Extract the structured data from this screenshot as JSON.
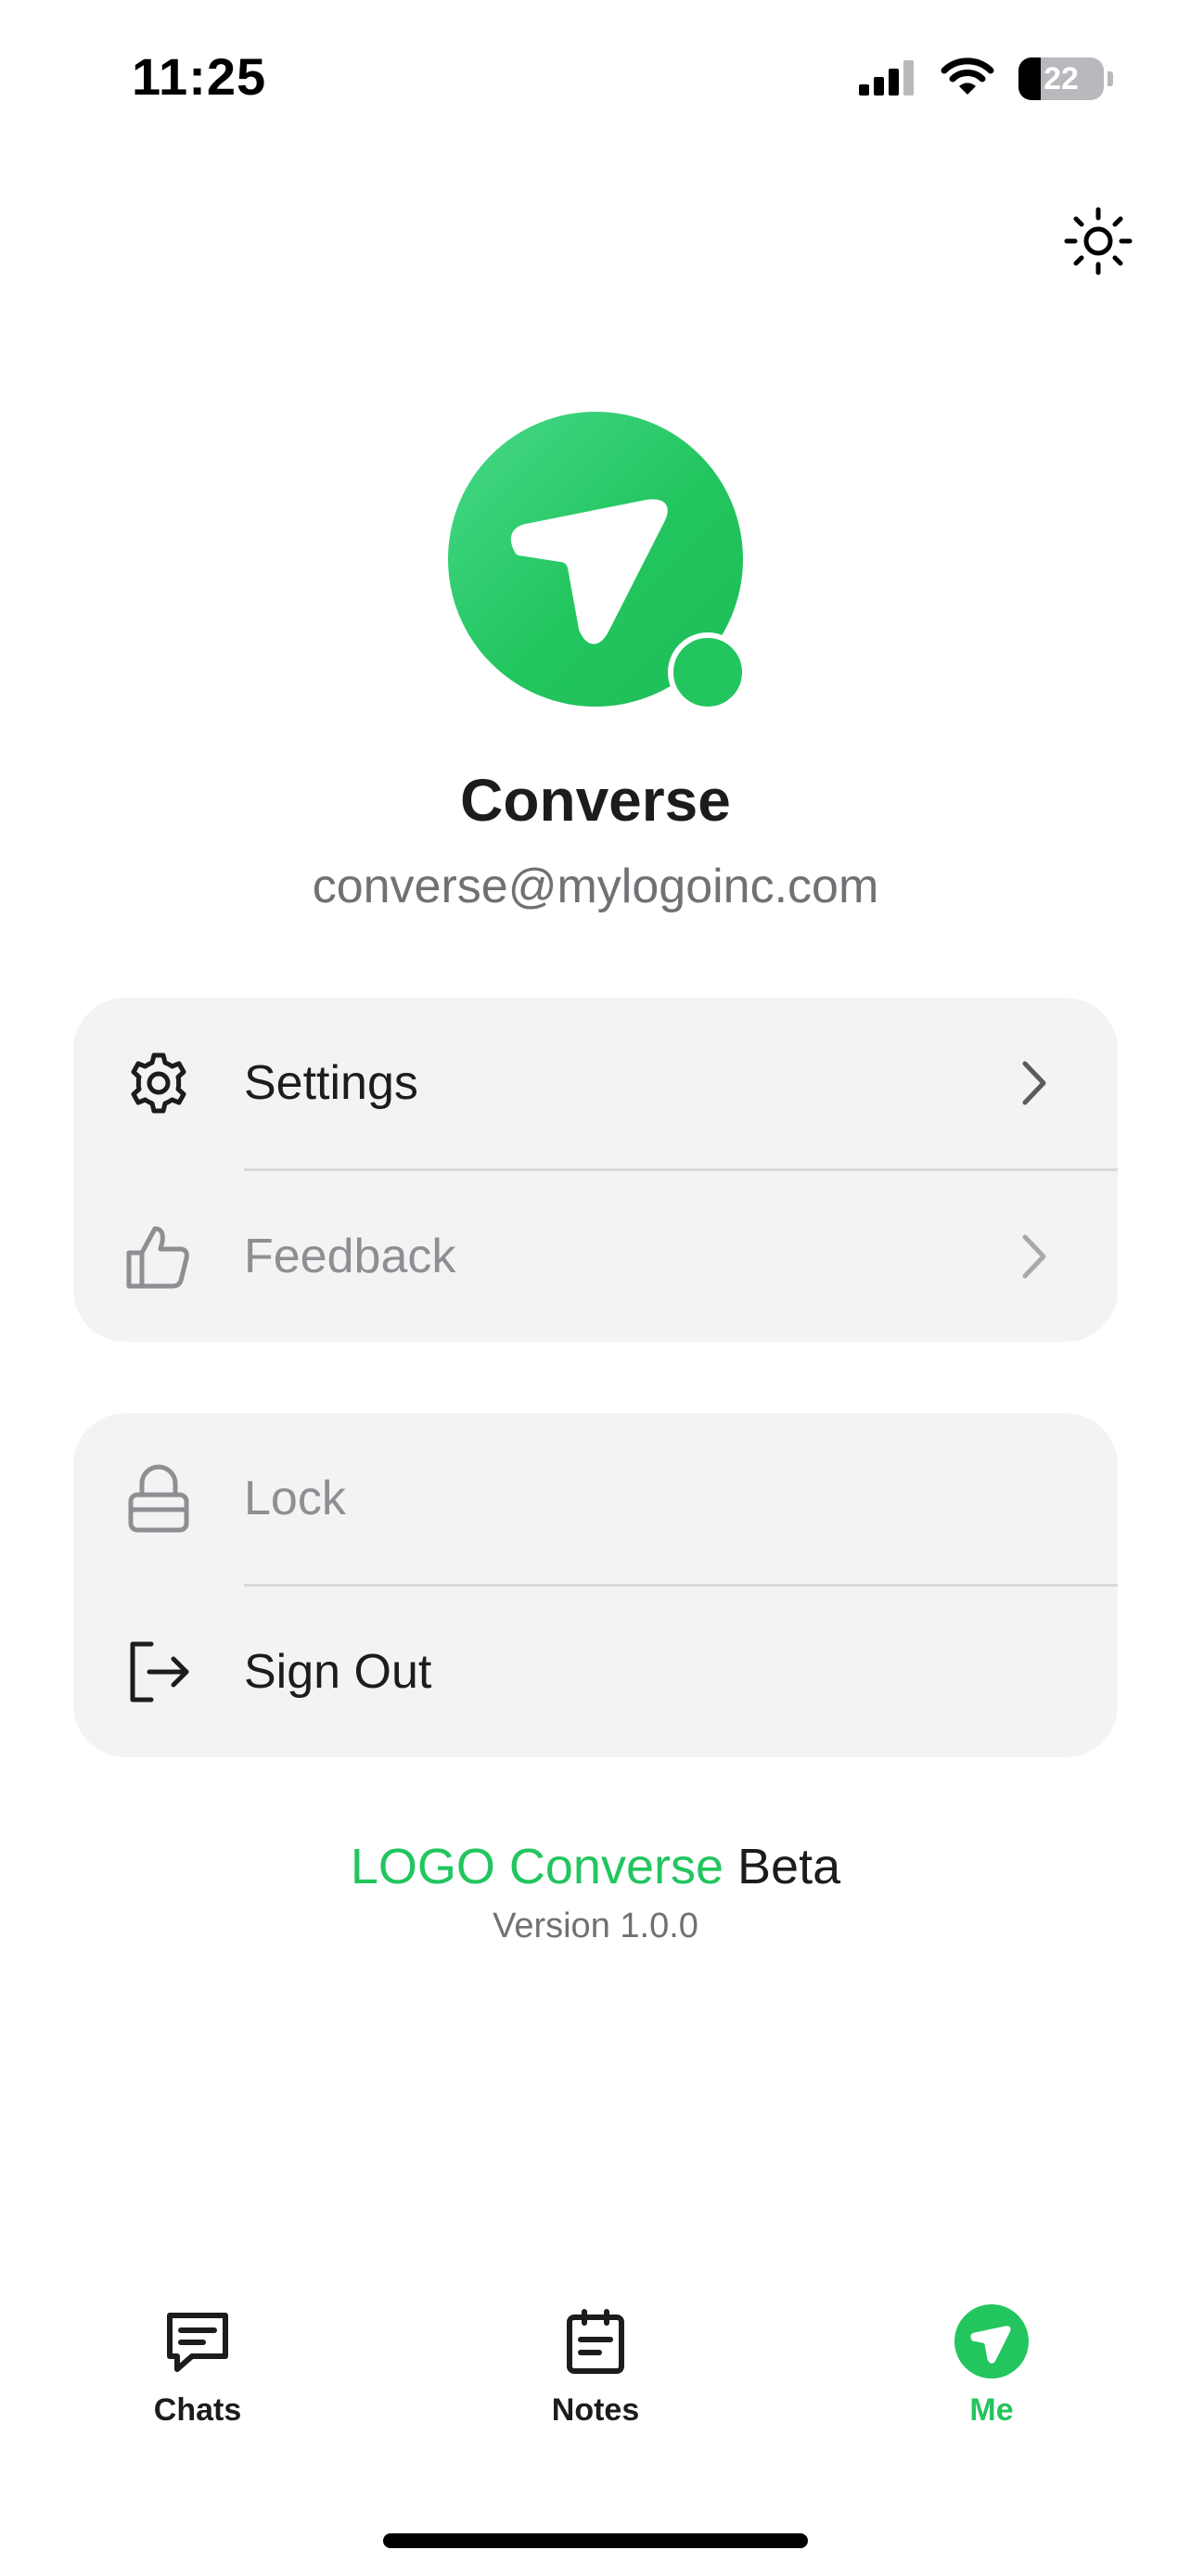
{
  "status_bar": {
    "time": "11:25",
    "battery_level": "22",
    "icons": [
      "signal-icon",
      "wifi-icon",
      "battery-icon"
    ]
  },
  "header": {
    "theme_toggle_icon": "sun-icon"
  },
  "profile": {
    "name": "Converse",
    "email": "converse@mylogoinc.com",
    "avatar_icon": "paper-plane-icon",
    "status": "online",
    "accent_color": "#22c55e"
  },
  "menu_groups": [
    {
      "items": [
        {
          "label": "Settings",
          "icon": "gear-icon",
          "enabled": true
        },
        {
          "label": "Feedback",
          "icon": "thumbs-up-icon",
          "enabled": false
        }
      ]
    },
    {
      "items": [
        {
          "label": "Lock",
          "icon": "lock-icon",
          "enabled": false
        },
        {
          "label": "Sign Out",
          "icon": "sign-out-icon",
          "enabled": true
        }
      ]
    }
  ],
  "footer": {
    "brand": "LOGO Converse",
    "badge": "Beta",
    "version": "Version 1.0.0"
  },
  "tabbar": {
    "tabs": [
      {
        "label": "Chats",
        "icon": "chat-icon",
        "active": false
      },
      {
        "label": "Notes",
        "icon": "notes-icon",
        "active": false
      },
      {
        "label": "Me",
        "icon": "paper-plane-icon",
        "active": true
      }
    ]
  },
  "colors": {
    "accent": "#22c55e",
    "card_background": "#f3f3f4",
    "muted_text": "#8e8e93"
  }
}
